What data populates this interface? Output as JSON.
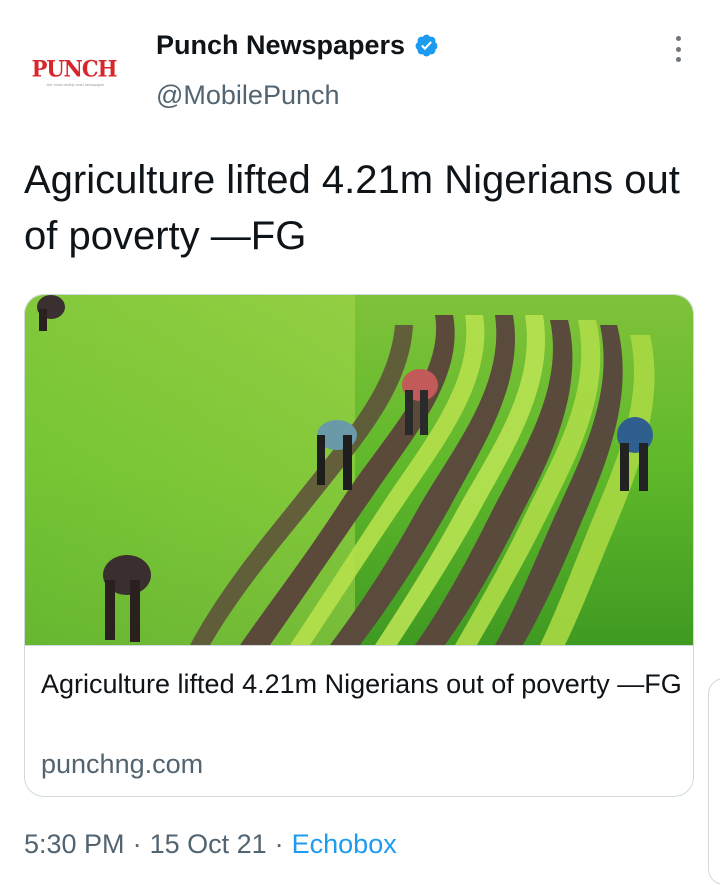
{
  "header": {
    "avatar_logo_text": "PUNCH",
    "avatar_logo_tagline": "...the most widely read newspaper",
    "display_name": "Punch Newspapers",
    "handle": "@MobilePunch"
  },
  "tweet": {
    "text": "Agriculture lifted 4.21m Nigerians out of poverty —FG"
  },
  "card": {
    "title": "Agriculture lifted 4.21m Nigerians out of poverty —FG",
    "domain": "punchng.com"
  },
  "meta": {
    "time": "5:30 PM",
    "date": "15 Oct 21",
    "source": "Echobox"
  },
  "colors": {
    "verified_badge": "#1d9bf0",
    "link": "#1d9bf0",
    "secondary_text": "#536471",
    "logo_red": "#d8262d"
  },
  "icons": {
    "verified": "verified-badge-icon",
    "more": "more-vertical-icon"
  }
}
